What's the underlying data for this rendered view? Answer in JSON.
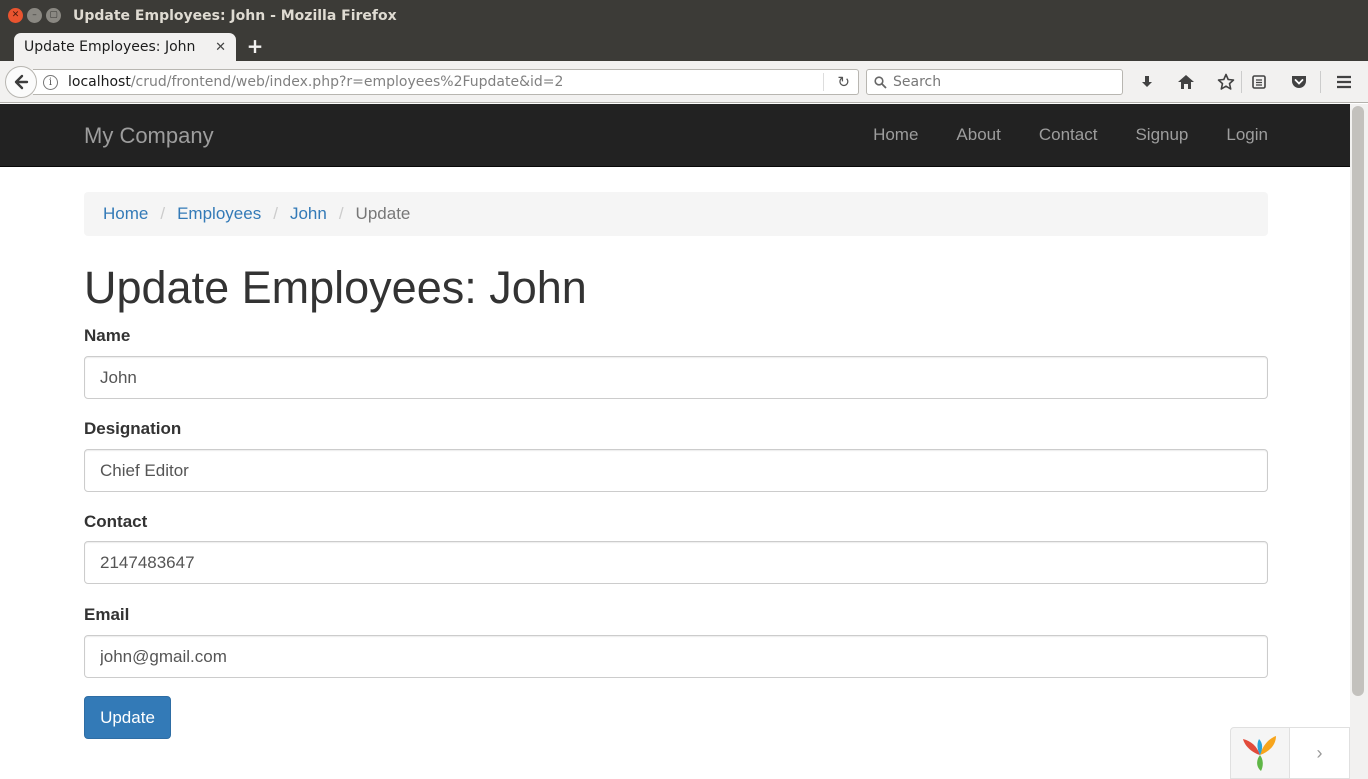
{
  "window": {
    "title": "Update Employees: John - Mozilla Firefox",
    "close_glyph": "✕",
    "min_glyph": "–",
    "max_glyph": "▢"
  },
  "tab": {
    "title": "Update Employees: John",
    "close_glyph": "✕",
    "new_tab_glyph": "+"
  },
  "urlbar": {
    "host": "localhost",
    "path": "/crud/frontend/web/index.php?r=employees%2Fupdate&id=2",
    "back_glyph": "🡐",
    "info_glyph": "i",
    "reload_glyph": "↻"
  },
  "searchbar": {
    "placeholder": "Search",
    "icon_glyph": "⚲"
  },
  "toolbar": {
    "download_glyph": "⬇",
    "home_glyph": "⌂",
    "bookmark_glyph": "☆",
    "reading_glyph": "▤",
    "pocket_glyph": "⛉",
    "menu_glyph": "≡"
  },
  "site": {
    "brand": "My Company",
    "nav": [
      "Home",
      "About",
      "Contact",
      "Signup",
      "Login"
    ]
  },
  "breadcrumb": {
    "items": [
      "Home",
      "Employees",
      "John"
    ],
    "active": "Update",
    "separator": "/"
  },
  "page": {
    "title": "Update Employees: John"
  },
  "form": {
    "fields": [
      {
        "label": "Name",
        "value": "John"
      },
      {
        "label": "Designation",
        "value": "Chief Editor"
      },
      {
        "label": "Contact",
        "value": "2147483647"
      },
      {
        "label": "Email",
        "value": "john@gmail.com"
      }
    ],
    "submit_label": "Update"
  },
  "debug": {
    "arrow_glyph": "›"
  },
  "colors": {
    "navbar_bg": "#222222",
    "link": "#337ab7",
    "button": "#337ab7",
    "ubuntu_close": "#e9542f"
  }
}
